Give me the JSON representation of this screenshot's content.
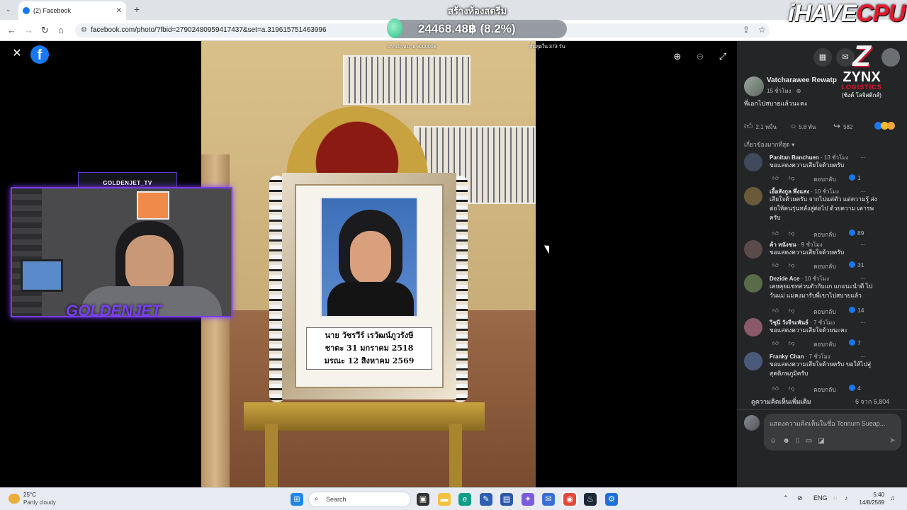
{
  "browser": {
    "tab_title": "(2) Facebook",
    "url": "facebook.com/photo/?fbid=27902480959417437&set=a.319615751463996"
  },
  "overlay": {
    "title": "สร้างห้องสตรีม",
    "amount": "24468.48฿ (8.2%)",
    "goal": "จากเป้าหมาย 300000฿",
    "remaining": "สิ้นสุดใน 373 วัน",
    "logo_white": "iHAVE",
    "logo_red": "CPU"
  },
  "viewer": {
    "nameplate": [
      "นาย วัชรวีร์ เรวัฒน์ภูวรังษี",
      "ชาตะ 31 มกราคม 2518",
      "มรณะ 12 สิงหาคม 2569"
    ]
  },
  "webcam": {
    "label": "GOLDENJET_TV",
    "name": "GOLDENJET"
  },
  "sponsor": {
    "letter": "Z",
    "name": "ZYNX",
    "sub": "LOGISTICS",
    "thai": "(ซิงค์ โลจิสติกส์)"
  },
  "post": {
    "author": "Vatcharawee Rewatp",
    "time": "15 ชั่วโมง · ⊕",
    "text": "พี่เอกไปสบายแล้วนะคะ",
    "likes": "2.1 หมื่น",
    "comments": "5.8 พัน",
    "shares": "582",
    "sort_label": "เกี่ยวข้องมากที่สุด ▾"
  },
  "comments": [
    {
      "name": "Panitan Banchuen",
      "time": " · 13 ชั่วโมง",
      "text": "ขอแสดงความเสียใจด้วยครับ",
      "reply": "ตอบกลับ",
      "likes": "1",
      "avatar": "#3f4a5c"
    },
    {
      "name": "เอื้อสังกูล พึ่งแสง",
      "time": " · 10 ชั่วโมง",
      "text": "เสียใจด้วยครับ จากไปแต่ตัว แต่ความรู้ ส่งต่อให้คนรุ่นหลังสู่ต่อไป ด้วยความ เคารพครับ",
      "reply": "ตอบกลับ",
      "likes": "89",
      "avatar": "#6b5a3a"
    },
    {
      "name": "ค้า หนังขน",
      "time": " · 9 ชั่วโมง",
      "text": "ขอแสดงความเสียใจด้วยครับ",
      "reply": "ตอบกลับ",
      "likes": "31",
      "avatar": "#5b4a4a"
    },
    {
      "name": "Dezide Ace",
      "time": " · 10 ชั่วโมง",
      "text": "เคยคุยแชทส่วนตัวกับแก แกแนะนำดี ไป วันแม่ แม่คงมารับพี่เขาไปสบายแล้ว",
      "reply": "ตอบกลับ",
      "likes": "14",
      "avatar": "#5a6b4a"
    },
    {
      "name": "วิชุนี วังจีระพันธ์",
      "time": " · 7 ชั่วโมง",
      "text": "ขอแสดงความเสียใจด้วยนะคะ",
      "reply": "ตอบกลับ",
      "likes": "7",
      "avatar": "#8a5a6a"
    },
    {
      "name": "Franky Chan",
      "time": " · 7 ชั่วโมง",
      "text": "ขอแสดงความเสียใจด้วยครับ ขอให้ไปสู่ สุคติภพภูมิครับ",
      "reply": "ตอบกลับ",
      "likes": "4",
      "avatar": "#4a5a7a"
    }
  ],
  "comments_footer": {
    "more": "ดูความคิดเห็นเพิ่มเติม",
    "count": "6 จาก 5,804",
    "placeholder": "แสดงความคิดเห็นในชื่อ Tonnum Sueap..."
  },
  "taskbar": {
    "temp": "25°C",
    "condition": "Partly cloudy",
    "search": "Search",
    "lang": "ENG",
    "time": "5:40",
    "date": "14/8/2569"
  }
}
